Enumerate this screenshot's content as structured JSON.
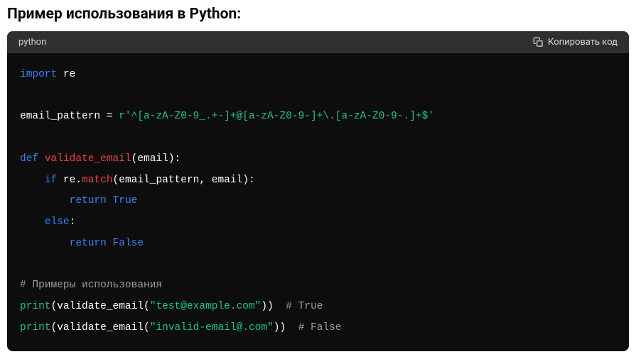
{
  "heading": "Пример использования в Python:",
  "code_block": {
    "language": "python",
    "copy_label": "Копировать код",
    "lines": [
      [
        {
          "t": "import ",
          "c": "tok-kw"
        },
        {
          "t": "re",
          "c": "tok-mod"
        }
      ],
      [],
      [
        {
          "t": "email_pattern = ",
          "c": "tok-p"
        },
        {
          "t": "r'^[a-zA-Z0-9_.+-]+@[a-zA-Z0-9-]+\\.[a-zA-Z0-9-.]+$'",
          "c": "tok-str"
        }
      ],
      [],
      [
        {
          "t": "def ",
          "c": "tok-kw"
        },
        {
          "t": "validate_email",
          "c": "tok-fn"
        },
        {
          "t": "(",
          "c": "tok-p"
        },
        {
          "t": "email",
          "c": "tok-mod"
        },
        {
          "t": "):",
          "c": "tok-p"
        }
      ],
      [
        {
          "t": "    ",
          "c": "tok-p"
        },
        {
          "t": "if ",
          "c": "tok-kw"
        },
        {
          "t": "re.",
          "c": "tok-mod"
        },
        {
          "t": "match",
          "c": "tok-call"
        },
        {
          "t": "(email_pattern, email):",
          "c": "tok-p"
        }
      ],
      [
        {
          "t": "        ",
          "c": "tok-p"
        },
        {
          "t": "return ",
          "c": "tok-kw"
        },
        {
          "t": "True",
          "c": "tok-bool"
        }
      ],
      [
        {
          "t": "    ",
          "c": "tok-p"
        },
        {
          "t": "else",
          "c": "tok-kw"
        },
        {
          "t": ":",
          "c": "tok-p"
        }
      ],
      [
        {
          "t": "        ",
          "c": "tok-p"
        },
        {
          "t": "return ",
          "c": "tok-kw"
        },
        {
          "t": "False",
          "c": "tok-bool"
        }
      ],
      [],
      [
        {
          "t": "# Примеры использования",
          "c": "tok-com"
        }
      ],
      [
        {
          "t": "print",
          "c": "tok-bi"
        },
        {
          "t": "(",
          "c": "tok-p"
        },
        {
          "t": "validate_email",
          "c": "tok-mod"
        },
        {
          "t": "(",
          "c": "tok-p"
        },
        {
          "t": "\"test@example.com\"",
          "c": "tok-str"
        },
        {
          "t": "))  ",
          "c": "tok-p"
        },
        {
          "t": "# True",
          "c": "tok-com"
        }
      ],
      [
        {
          "t": "print",
          "c": "tok-bi"
        },
        {
          "t": "(",
          "c": "tok-p"
        },
        {
          "t": "validate_email",
          "c": "tok-mod"
        },
        {
          "t": "(",
          "c": "tok-p"
        },
        {
          "t": "\"invalid-email@.com\"",
          "c": "tok-str"
        },
        {
          "t": "))  ",
          "c": "tok-p"
        },
        {
          "t": "# False",
          "c": "tok-com"
        }
      ]
    ]
  }
}
